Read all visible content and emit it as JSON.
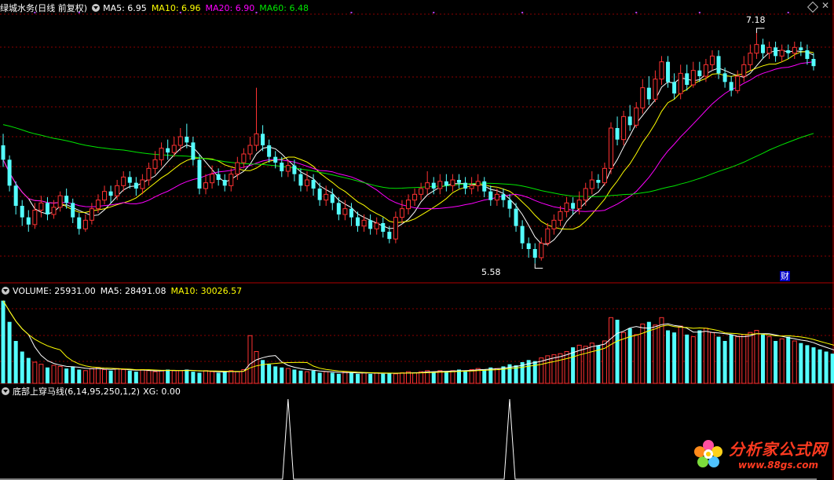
{
  "header_main": {
    "title": "绿城水务(日线 前复权)",
    "ma5": "MA5: 6.95",
    "ma10": "MA10: 6.96",
    "ma20": "MA20: 6.90",
    "ma60": "MA60: 6.48"
  },
  "header_volume": {
    "title": "VOLUME: 25931.00",
    "ma5": "MA5: 28491.08",
    "ma10": "MA10: 30026.57"
  },
  "header_indicator": {
    "title": "底部上穿马线(6,14,95,250,1,2)",
    "xg": "XG: 0.00"
  },
  "annotations": {
    "high_label": "7.18",
    "low_label": "5.58",
    "fin_marker": "财"
  },
  "watermark": {
    "title": "分析家公式网",
    "url": "www.88gs.com"
  },
  "colors": {
    "up": "#ff3232",
    "down": "#54ffff",
    "ma5": "#ffffff",
    "ma10": "#ffff00",
    "ma20": "#ff00ff",
    "ma60": "#00e600",
    "grid": "#8b0000",
    "separator": "#b00000"
  },
  "chart_data": [
    {
      "type": "candlestick",
      "title": "绿城水务(日线 前复权)",
      "ylim": [
        5.5,
        7.3
      ],
      "max_label": 7.18,
      "min_label": 5.58,
      "series_ma": [
        {
          "name": "MA5",
          "last": 6.95
        },
        {
          "name": "MA10",
          "last": 6.96
        },
        {
          "name": "MA20",
          "last": 6.9
        },
        {
          "name": "MA60",
          "last": 6.48
        }
      ],
      "ohlc": [
        [
          6.4,
          6.3,
          6.48,
          6.25
        ],
        [
          6.3,
          6.12,
          6.33,
          6.08
        ],
        [
          6.12,
          5.98,
          6.15,
          5.92
        ],
        [
          5.98,
          5.9,
          6.02,
          5.84
        ],
        [
          5.9,
          5.85,
          5.95,
          5.8
        ],
        [
          5.85,
          5.95,
          6.0,
          5.82
        ],
        [
          5.95,
          6.0,
          6.05,
          5.9
        ],
        [
          6.0,
          5.92,
          6.04,
          5.88
        ],
        [
          5.92,
          5.97,
          6.02,
          5.89
        ],
        [
          5.97,
          6.05,
          6.08,
          5.94
        ],
        [
          6.05,
          6.0,
          6.1,
          5.96
        ],
        [
          6.0,
          5.9,
          6.03,
          5.86
        ],
        [
          5.9,
          5.82,
          5.93,
          5.78
        ],
        [
          5.82,
          5.88,
          5.92,
          5.8
        ],
        [
          5.88,
          5.96,
          6.0,
          5.85
        ],
        [
          5.96,
          6.02,
          6.06,
          5.93
        ],
        [
          6.02,
          6.08,
          6.12,
          5.99
        ],
        [
          6.08,
          6.05,
          6.12,
          6.0
        ],
        [
          6.05,
          6.12,
          6.16,
          6.02
        ],
        [
          6.12,
          6.18,
          6.22,
          6.08
        ],
        [
          6.18,
          6.14,
          6.22,
          6.1
        ],
        [
          6.14,
          6.1,
          6.18,
          6.05
        ],
        [
          6.1,
          6.16,
          6.2,
          6.06
        ],
        [
          6.16,
          6.24,
          6.28,
          6.12
        ],
        [
          6.24,
          6.3,
          6.36,
          6.2
        ],
        [
          6.3,
          6.38,
          6.42,
          6.26
        ],
        [
          6.38,
          6.35,
          6.44,
          6.3
        ],
        [
          6.35,
          6.4,
          6.46,
          6.32
        ],
        [
          6.4,
          6.46,
          6.52,
          6.36
        ],
        [
          6.46,
          6.42,
          6.55,
          6.38
        ],
        [
          6.42,
          6.3,
          6.46,
          6.26
        ],
        [
          6.3,
          6.1,
          6.34,
          6.06
        ],
        [
          6.1,
          6.14,
          6.2,
          6.06
        ],
        [
          6.14,
          6.2,
          6.26,
          6.1
        ],
        [
          6.2,
          6.16,
          6.24,
          6.12
        ],
        [
          6.16,
          6.12,
          6.2,
          6.08
        ],
        [
          6.12,
          6.2,
          6.24,
          6.08
        ],
        [
          6.2,
          6.28,
          6.32,
          6.16
        ],
        [
          6.28,
          6.34,
          6.38,
          6.24
        ],
        [
          6.34,
          6.4,
          6.46,
          6.3
        ],
        [
          6.4,
          6.48,
          6.8,
          6.36
        ],
        [
          6.48,
          6.4,
          6.54,
          6.36
        ],
        [
          6.4,
          6.32,
          6.44,
          6.28
        ],
        [
          6.32,
          6.28,
          6.36,
          6.24
        ],
        [
          6.28,
          6.22,
          6.32,
          6.18
        ],
        [
          6.22,
          6.26,
          6.3,
          6.18
        ],
        [
          6.26,
          6.2,
          6.3,
          6.15
        ],
        [
          6.2,
          6.12,
          6.24,
          6.08
        ],
        [
          6.12,
          6.16,
          6.22,
          6.08
        ],
        [
          6.16,
          6.1,
          6.2,
          6.05
        ],
        [
          6.1,
          6.02,
          6.14,
          5.98
        ],
        [
          6.02,
          6.06,
          6.12,
          5.98
        ],
        [
          6.06,
          6.0,
          6.1,
          5.95
        ],
        [
          6.0,
          5.92,
          6.04,
          5.88
        ],
        [
          5.92,
          5.96,
          6.02,
          5.88
        ],
        [
          5.96,
          5.9,
          6.0,
          5.84
        ],
        [
          5.9,
          5.84,
          5.94,
          5.8
        ],
        [
          5.84,
          5.88,
          5.92,
          5.8
        ],
        [
          5.88,
          5.82,
          5.92,
          5.78
        ],
        [
          5.82,
          5.86,
          5.9,
          5.78
        ],
        [
          5.86,
          5.8,
          5.9,
          5.76
        ],
        [
          5.8,
          5.75,
          5.84,
          5.72
        ],
        [
          5.75,
          5.9,
          5.94,
          5.72
        ],
        [
          5.9,
          5.96,
          6.02,
          5.86
        ],
        [
          5.96,
          6.02,
          6.06,
          5.92
        ],
        [
          6.02,
          6.06,
          6.1,
          5.98
        ],
        [
          6.06,
          6.1,
          6.14,
          6.02
        ],
        [
          6.1,
          6.14,
          6.22,
          6.06
        ],
        [
          6.14,
          6.1,
          6.18,
          6.06
        ],
        [
          6.1,
          6.15,
          6.2,
          6.06
        ],
        [
          6.15,
          6.12,
          6.2,
          6.08
        ],
        [
          6.12,
          6.16,
          6.2,
          6.08
        ],
        [
          6.16,
          6.14,
          6.2,
          6.1
        ],
        [
          6.14,
          6.1,
          6.18,
          6.06
        ],
        [
          6.1,
          6.12,
          6.18,
          6.06
        ],
        [
          6.12,
          6.15,
          6.2,
          6.08
        ],
        [
          6.15,
          6.08,
          6.18,
          6.04
        ],
        [
          6.08,
          6.02,
          6.12,
          5.98
        ],
        [
          6.02,
          6.06,
          6.1,
          5.98
        ],
        [
          6.06,
          6.02,
          6.1,
          5.97
        ],
        [
          6.02,
          5.96,
          6.06,
          5.9
        ],
        [
          5.96,
          5.84,
          6.0,
          5.8
        ],
        [
          5.84,
          5.72,
          5.88,
          5.68
        ],
        [
          5.72,
          5.68,
          5.76,
          5.62
        ],
        [
          5.68,
          5.62,
          5.72,
          5.58
        ],
        [
          5.62,
          5.72,
          5.76,
          5.6
        ],
        [
          5.72,
          5.82,
          5.86,
          5.7
        ],
        [
          5.82,
          5.88,
          5.92,
          5.78
        ],
        [
          5.88,
          5.94,
          5.98,
          5.84
        ],
        [
          5.94,
          6.0,
          6.04,
          5.9
        ],
        [
          6.0,
          5.96,
          6.04,
          5.92
        ],
        [
          5.96,
          6.02,
          6.08,
          5.92
        ],
        [
          6.02,
          6.1,
          6.14,
          5.98
        ],
        [
          6.1,
          6.16,
          6.22,
          6.06
        ],
        [
          6.16,
          6.14,
          6.2,
          6.1
        ],
        [
          6.14,
          6.24,
          6.28,
          6.12
        ],
        [
          6.24,
          6.52,
          6.56,
          6.2
        ],
        [
          6.52,
          6.44,
          6.6,
          6.4
        ],
        [
          6.44,
          6.6,
          6.64,
          6.4
        ],
        [
          6.6,
          6.54,
          6.68,
          6.5
        ],
        [
          6.54,
          6.66,
          6.7,
          6.52
        ],
        [
          6.66,
          6.8,
          6.86,
          6.62
        ],
        [
          6.8,
          6.72,
          6.88,
          6.68
        ],
        [
          6.72,
          6.86,
          6.92,
          6.7
        ],
        [
          6.86,
          6.98,
          7.02,
          6.82
        ],
        [
          6.98,
          6.84,
          7.02,
          6.8
        ],
        [
          6.84,
          6.76,
          6.9,
          6.72
        ],
        [
          6.76,
          6.9,
          6.96,
          6.72
        ],
        [
          6.9,
          6.82,
          6.96,
          6.78
        ],
        [
          6.82,
          6.92,
          6.98,
          6.8
        ],
        [
          6.92,
          6.88,
          6.98,
          6.84
        ],
        [
          6.88,
          6.96,
          7.0,
          6.84
        ],
        [
          6.96,
          7.02,
          7.06,
          6.92
        ],
        [
          7.02,
          6.9,
          7.06,
          6.86
        ],
        [
          6.9,
          6.84,
          6.94,
          6.8
        ],
        [
          6.84,
          6.78,
          6.88,
          6.74
        ],
        [
          6.78,
          6.88,
          6.92,
          6.76
        ],
        [
          6.88,
          6.96,
          7.02,
          6.84
        ],
        [
          6.96,
          7.04,
          7.1,
          6.92
        ],
        [
          7.04,
          7.1,
          7.18,
          7.0
        ],
        [
          7.1,
          7.04,
          7.14,
          7.0
        ],
        [
          7.04,
          7.08,
          7.12,
          7.0
        ],
        [
          7.08,
          7.02,
          7.12,
          6.98
        ],
        [
          7.02,
          7.06,
          7.1,
          6.98
        ],
        [
          7.06,
          7.04,
          7.1,
          7.0
        ],
        [
          7.04,
          7.08,
          7.12,
          7.0
        ],
        [
          7.08,
          7.06,
          7.12,
          7.02
        ],
        [
          7.06,
          7.0,
          7.1,
          6.96
        ],
        [
          7.0,
          6.95,
          7.04,
          6.92
        ]
      ]
    },
    {
      "type": "bar",
      "title": "VOLUME",
      "last": 25931.0,
      "ma5_last": 28491.08,
      "ma10_last": 30026.57,
      "ylim": [
        0,
        80000
      ],
      "values": [
        78000,
        58000,
        40000,
        30000,
        24000,
        20000,
        18000,
        15000,
        17000,
        16000,
        14000,
        16000,
        13000,
        12000,
        14000,
        15000,
        13000,
        12000,
        14000,
        13000,
        12000,
        11000,
        13000,
        12000,
        11000,
        12000,
        13000,
        12000,
        12000,
        13000,
        11000,
        10000,
        12000,
        11000,
        10000,
        11000,
        12000,
        11000,
        13000,
        45000,
        30000,
        22000,
        18000,
        16000,
        15000,
        14000,
        13000,
        12000,
        11000,
        12000,
        10000,
        11000,
        10000,
        9000,
        11000,
        10000,
        9000,
        10000,
        9000,
        10000,
        9000,
        10000,
        9000,
        10000,
        11000,
        10000,
        11000,
        12000,
        11000,
        12000,
        11000,
        12000,
        13000,
        12000,
        13000,
        14000,
        13000,
        15000,
        14000,
        16000,
        18000,
        17000,
        20000,
        22000,
        21000,
        24000,
        26000,
        27000,
        28000,
        30000,
        34000,
        36000,
        35000,
        38000,
        36000,
        40000,
        62000,
        60000,
        48000,
        52000,
        46000,
        56000,
        58000,
        55000,
        62000,
        50000,
        48000,
        54000,
        46000,
        44000,
        50000,
        52000,
        48000,
        44000,
        40000,
        46000,
        44000,
        46000,
        48000,
        50000,
        46000,
        44000,
        40000,
        42000,
        44000,
        40000,
        38000,
        36000,
        34000,
        32000,
        30000,
        28000,
        26000,
        25931
      ]
    },
    {
      "type": "line",
      "title": "底部上穿马线(6,14,95,250,1,2)",
      "series": [
        {
          "name": "XG",
          "last": 0.0,
          "spikes_at_bar_index": [
            45,
            80
          ]
        }
      ]
    }
  ]
}
